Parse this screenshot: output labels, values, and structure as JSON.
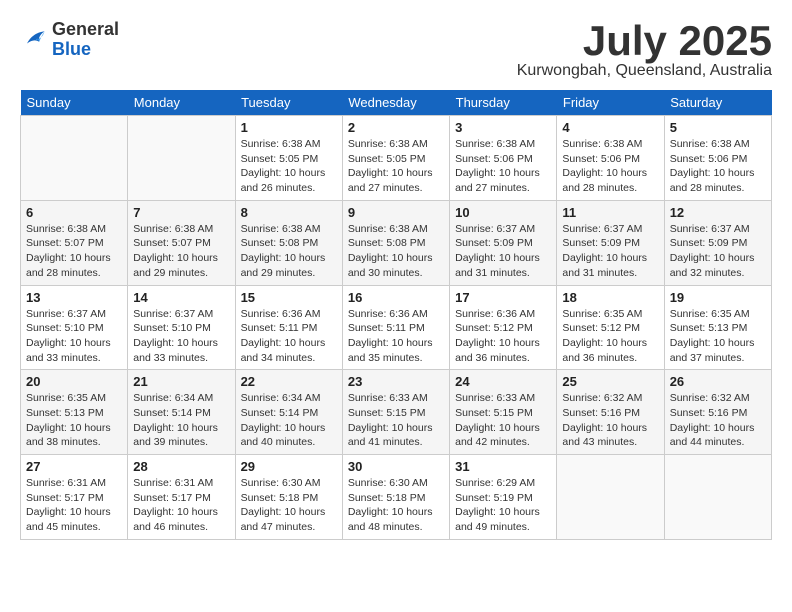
{
  "header": {
    "logo": {
      "general": "General",
      "blue": "Blue"
    },
    "title": "July 2025",
    "location": "Kurwongbah, Queensland, Australia"
  },
  "calendar": {
    "weekdays": [
      "Sunday",
      "Monday",
      "Tuesday",
      "Wednesday",
      "Thursday",
      "Friday",
      "Saturday"
    ],
    "weeks": [
      [
        {
          "day": "",
          "info": ""
        },
        {
          "day": "",
          "info": ""
        },
        {
          "day": "1",
          "info": "Sunrise: 6:38 AM\nSunset: 5:05 PM\nDaylight: 10 hours\nand 26 minutes."
        },
        {
          "day": "2",
          "info": "Sunrise: 6:38 AM\nSunset: 5:05 PM\nDaylight: 10 hours\nand 27 minutes."
        },
        {
          "day": "3",
          "info": "Sunrise: 6:38 AM\nSunset: 5:06 PM\nDaylight: 10 hours\nand 27 minutes."
        },
        {
          "day": "4",
          "info": "Sunrise: 6:38 AM\nSunset: 5:06 PM\nDaylight: 10 hours\nand 28 minutes."
        },
        {
          "day": "5",
          "info": "Sunrise: 6:38 AM\nSunset: 5:06 PM\nDaylight: 10 hours\nand 28 minutes."
        }
      ],
      [
        {
          "day": "6",
          "info": "Sunrise: 6:38 AM\nSunset: 5:07 PM\nDaylight: 10 hours\nand 28 minutes."
        },
        {
          "day": "7",
          "info": "Sunrise: 6:38 AM\nSunset: 5:07 PM\nDaylight: 10 hours\nand 29 minutes."
        },
        {
          "day": "8",
          "info": "Sunrise: 6:38 AM\nSunset: 5:08 PM\nDaylight: 10 hours\nand 29 minutes."
        },
        {
          "day": "9",
          "info": "Sunrise: 6:38 AM\nSunset: 5:08 PM\nDaylight: 10 hours\nand 30 minutes."
        },
        {
          "day": "10",
          "info": "Sunrise: 6:37 AM\nSunset: 5:09 PM\nDaylight: 10 hours\nand 31 minutes."
        },
        {
          "day": "11",
          "info": "Sunrise: 6:37 AM\nSunset: 5:09 PM\nDaylight: 10 hours\nand 31 minutes."
        },
        {
          "day": "12",
          "info": "Sunrise: 6:37 AM\nSunset: 5:09 PM\nDaylight: 10 hours\nand 32 minutes."
        }
      ],
      [
        {
          "day": "13",
          "info": "Sunrise: 6:37 AM\nSunset: 5:10 PM\nDaylight: 10 hours\nand 33 minutes."
        },
        {
          "day": "14",
          "info": "Sunrise: 6:37 AM\nSunset: 5:10 PM\nDaylight: 10 hours\nand 33 minutes."
        },
        {
          "day": "15",
          "info": "Sunrise: 6:36 AM\nSunset: 5:11 PM\nDaylight: 10 hours\nand 34 minutes."
        },
        {
          "day": "16",
          "info": "Sunrise: 6:36 AM\nSunset: 5:11 PM\nDaylight: 10 hours\nand 35 minutes."
        },
        {
          "day": "17",
          "info": "Sunrise: 6:36 AM\nSunset: 5:12 PM\nDaylight: 10 hours\nand 36 minutes."
        },
        {
          "day": "18",
          "info": "Sunrise: 6:35 AM\nSunset: 5:12 PM\nDaylight: 10 hours\nand 36 minutes."
        },
        {
          "day": "19",
          "info": "Sunrise: 6:35 AM\nSunset: 5:13 PM\nDaylight: 10 hours\nand 37 minutes."
        }
      ],
      [
        {
          "day": "20",
          "info": "Sunrise: 6:35 AM\nSunset: 5:13 PM\nDaylight: 10 hours\nand 38 minutes."
        },
        {
          "day": "21",
          "info": "Sunrise: 6:34 AM\nSunset: 5:14 PM\nDaylight: 10 hours\nand 39 minutes."
        },
        {
          "day": "22",
          "info": "Sunrise: 6:34 AM\nSunset: 5:14 PM\nDaylight: 10 hours\nand 40 minutes."
        },
        {
          "day": "23",
          "info": "Sunrise: 6:33 AM\nSunset: 5:15 PM\nDaylight: 10 hours\nand 41 minutes."
        },
        {
          "day": "24",
          "info": "Sunrise: 6:33 AM\nSunset: 5:15 PM\nDaylight: 10 hours\nand 42 minutes."
        },
        {
          "day": "25",
          "info": "Sunrise: 6:32 AM\nSunset: 5:16 PM\nDaylight: 10 hours\nand 43 minutes."
        },
        {
          "day": "26",
          "info": "Sunrise: 6:32 AM\nSunset: 5:16 PM\nDaylight: 10 hours\nand 44 minutes."
        }
      ],
      [
        {
          "day": "27",
          "info": "Sunrise: 6:31 AM\nSunset: 5:17 PM\nDaylight: 10 hours\nand 45 minutes."
        },
        {
          "day": "28",
          "info": "Sunrise: 6:31 AM\nSunset: 5:17 PM\nDaylight: 10 hours\nand 46 minutes."
        },
        {
          "day": "29",
          "info": "Sunrise: 6:30 AM\nSunset: 5:18 PM\nDaylight: 10 hours\nand 47 minutes."
        },
        {
          "day": "30",
          "info": "Sunrise: 6:30 AM\nSunset: 5:18 PM\nDaylight: 10 hours\nand 48 minutes."
        },
        {
          "day": "31",
          "info": "Sunrise: 6:29 AM\nSunset: 5:19 PM\nDaylight: 10 hours\nand 49 minutes."
        },
        {
          "day": "",
          "info": ""
        },
        {
          "day": "",
          "info": ""
        }
      ]
    ]
  }
}
